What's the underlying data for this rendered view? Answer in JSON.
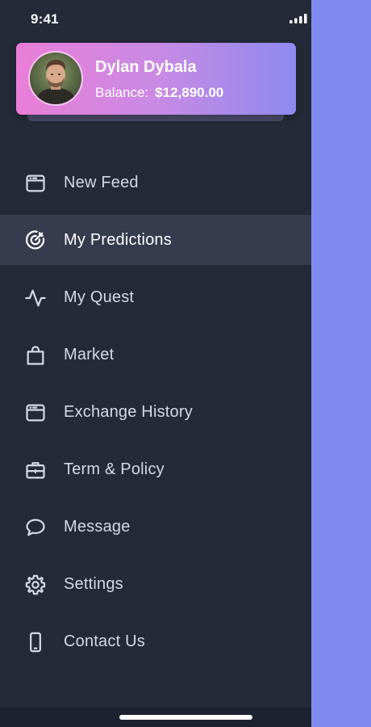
{
  "status_bar": {
    "time": "9:41",
    "signal_icon": "cellular-signal-icon"
  },
  "profile": {
    "name": "Dylan Dybala",
    "balance_label": "Balance:",
    "balance_value": "$12,890.00",
    "avatar_icon": "user-avatar",
    "gradient_start": "#EA7ED7",
    "gradient_end": "#8E8AEE"
  },
  "menu": {
    "items": [
      {
        "label": "New Feed",
        "icon": "browser-window-icon",
        "active": false
      },
      {
        "label": "My Predictions",
        "icon": "target-icon",
        "active": true
      },
      {
        "label": "My Quest",
        "icon": "activity-pulse-icon",
        "active": false
      },
      {
        "label": "Market",
        "icon": "shopping-bag-icon",
        "active": false
      },
      {
        "label": "Exchange History",
        "icon": "browser-window-icon",
        "active": false
      },
      {
        "label": "Term & Policy",
        "icon": "briefcase-icon",
        "active": false
      },
      {
        "label": "Message",
        "icon": "chat-bubble-icon",
        "active": false
      },
      {
        "label": "Settings",
        "icon": "gear-icon",
        "active": false
      },
      {
        "label": "Contact Us",
        "icon": "smartphone-icon",
        "active": false
      }
    ]
  },
  "colors": {
    "drawer_background": "#252A38",
    "active_item_background": "#363B4D",
    "overlay_background": "#7F8AEE",
    "menu_text": "#D4D9E6"
  }
}
